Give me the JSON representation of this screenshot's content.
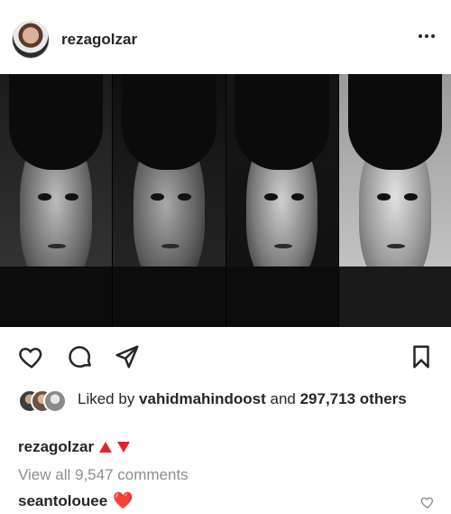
{
  "post": {
    "username": "rezagolzar",
    "more_label": "more options"
  },
  "actions": {
    "like": "heart-icon",
    "comment": "comment-icon",
    "share": "share-icon",
    "save": "save-icon"
  },
  "likes": {
    "prefix": "Liked by ",
    "liker": "vahidmahindoost",
    "middle": " and ",
    "count": "297,713",
    "suffix": " others"
  },
  "caption": {
    "username": "rezagolzar"
  },
  "comments": {
    "view_all": "View all 9,547 comments",
    "first": {
      "username": "seantolouee",
      "text": "❤️"
    }
  },
  "colors": {
    "accent_red": "#e0262b",
    "text": "#262626",
    "muted": "#8e8e8e"
  }
}
